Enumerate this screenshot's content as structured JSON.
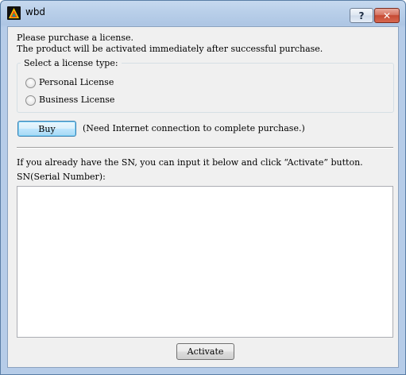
{
  "window": {
    "title": "wbd",
    "help_label": "?",
    "close_label": "✕",
    "icon": "app-icon"
  },
  "intro": {
    "line1": "Please purchase a license.",
    "line2": "The product will be activated immediately after successful purchase."
  },
  "license_group": {
    "label": "Select a license type:",
    "options": [
      {
        "label": "Personal License",
        "selected": false
      },
      {
        "label": "Business License",
        "selected": false
      }
    ]
  },
  "purchase": {
    "buy_label": "Buy",
    "note": "(Need Internet connection to complete purchase.)"
  },
  "activation": {
    "instruction": "If you already have the SN, you can input it below and click “Activate” button.",
    "sn_label": "SN(Serial Number):",
    "sn_value": "",
    "activate_label": "Activate"
  }
}
